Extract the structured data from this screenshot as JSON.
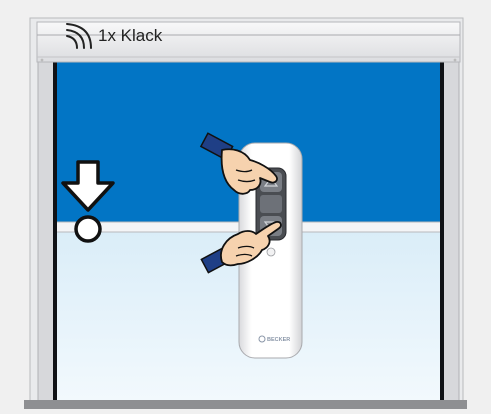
{
  "instruction": {
    "label": "1x Klack",
    "icon": "radio-signal-icon"
  },
  "remote": {
    "brand": "BECKER"
  },
  "shutter": {
    "position_fraction": 0.57
  },
  "colors": {
    "blind_fabric": "#0275c5",
    "window_glass": "#cfe9f7",
    "frame": "#dadbdf",
    "arrow": "#ffffff"
  },
  "icons": {
    "arrow": "down-arrow-icon",
    "stop_marker": "end-position-marker-icon",
    "hand_top": "pointing-hand-icon",
    "hand_bottom": "pointing-hand-icon"
  }
}
